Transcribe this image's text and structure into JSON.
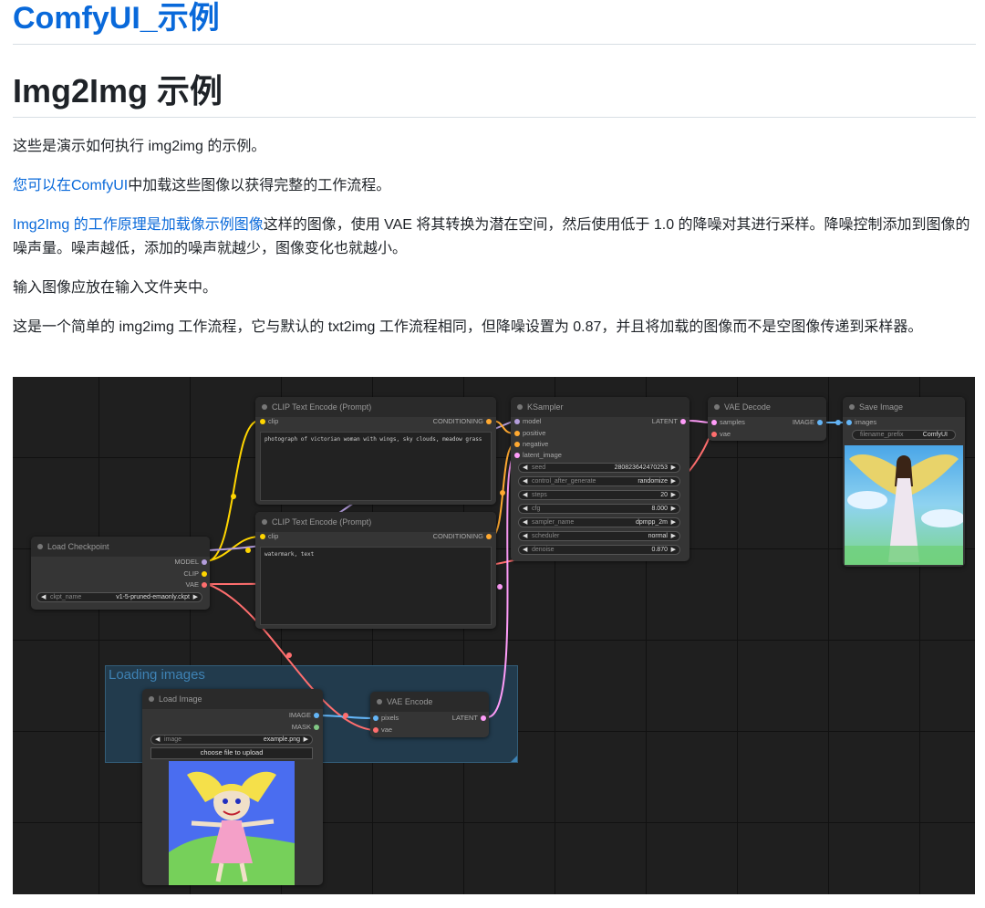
{
  "site_title": "ComfyUI_示例",
  "page_heading": "Img2Img 示例",
  "paragraphs": {
    "p1": "这些是演示如何执行 img2img 的示例。",
    "p2_link": "您可以在ComfyUI",
    "p2_rest": "中加载这些图像以获得完整的工作流程。",
    "p3_link": "Img2Img 的工作原理是加载像示例图像",
    "p3_rest": "这样的图像，使用 VAE 将其转换为潜在空间，然后使用低于 1.0 的降噪对其进行采样。降噪控制添加到图像的噪声量。噪声越低，添加的噪声就越少，图像变化也就越小。",
    "p4": "输入图像应放在输入文件夹中。",
    "p5": "这是一个简单的 img2img 工作流程，它与默认的 txt2img 工作流程相同，但降噪设置为 0.87，并且将加载的图像而不是空图像传递到采样器。"
  },
  "colors": {
    "link": "#0969da",
    "canvas_bg": "#1f1f1f",
    "node_bg": "#353535",
    "group_bg": "#223b4d"
  },
  "workflow": {
    "group": {
      "title": "Loading images"
    },
    "clip_pos": {
      "title": "CLIP Text Encode (Prompt)",
      "input_clip": "clip",
      "output": "CONDITIONING",
      "text": "photograph of victorian woman with wings, sky clouds, meadow grass"
    },
    "clip_neg": {
      "title": "CLIP Text Encode (Prompt)",
      "input_clip": "clip",
      "output": "CONDITIONING",
      "text": "watermark, text"
    },
    "checkpoint": {
      "title": "Load Checkpoint",
      "out_model": "MODEL",
      "out_clip": "CLIP",
      "out_vae": "VAE",
      "ckpt_label": "ckpt_name",
      "ckpt_value": "v1-5-pruned-emaonly.ckpt"
    },
    "ksampler": {
      "title": "KSampler",
      "in_model": "model",
      "in_positive": "positive",
      "in_negative": "negative",
      "in_latent": "latent_image",
      "output": "LATENT",
      "widgets": [
        {
          "label": "seed",
          "value": "280823642470253"
        },
        {
          "label": "control_after_generate",
          "value": "randomize"
        },
        {
          "label": "steps",
          "value": "20"
        },
        {
          "label": "cfg",
          "value": "8.000"
        },
        {
          "label": "sampler_name",
          "value": "dpmpp_2m"
        },
        {
          "label": "scheduler",
          "value": "normal"
        },
        {
          "label": "denoise",
          "value": "0.870"
        }
      ]
    },
    "vae_decode": {
      "title": "VAE Decode",
      "in_samples": "samples",
      "in_vae": "vae",
      "output": "IMAGE"
    },
    "save_image": {
      "title": "Save Image",
      "in_images": "images",
      "prefix_label": "filename_prefix",
      "prefix_value": "ComfyUI"
    },
    "load_image": {
      "title": "Load Image",
      "out_image": "IMAGE",
      "out_mask": "MASK",
      "image_label": "image",
      "image_value": "example.png",
      "upload_label": "choose file to upload"
    },
    "vae_encode": {
      "title": "VAE Encode",
      "in_pixels": "pixels",
      "in_vae": "vae",
      "output": "LATENT"
    }
  }
}
